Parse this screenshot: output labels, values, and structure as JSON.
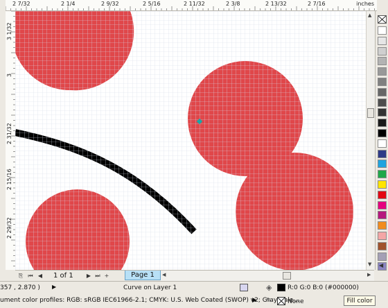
{
  "rulers": {
    "horizontal_labels": [
      "2  7/32",
      "2  1/4",
      "2  9/32",
      "2  5/16",
      "2  11/32",
      "2  3/8",
      "2  13/32",
      "2  7/16"
    ],
    "units": "inches",
    "vertical_labels": [
      "3  1/32",
      "3",
      "2  31/32",
      "2  15/16",
      "2  29/32"
    ]
  },
  "page_nav": {
    "first": "⏮",
    "prev": "◀",
    "next": "▶",
    "last": "⏭",
    "page_count": "1 of 1",
    "add_page": "+",
    "page_tab": "Page 1"
  },
  "status": {
    "coordinates": "357 , 2.870 )",
    "object_info": "Curve on Layer 1",
    "color_profiles": "ument color profiles: RGB: sRGB IEC61966-2.1; CMYK: U.S. Web Coated (SWOP) v2; Grayscale...",
    "fill_value": "R:0 G:0 B:0 (#000000)",
    "outline_value": "None",
    "tooltip": "Fill color"
  },
  "palette": {
    "colors": [
      "#ffffff",
      "#e6e6e6",
      "#cfcfcf",
      "#b3b3b3",
      "#999999",
      "#808080",
      "#666666",
      "#4d4d4d",
      "#333333",
      "#1a1a1a",
      "#000000",
      "#ffffff",
      "#2e3a87",
      "#1fa3df",
      "#1ea84a",
      "#ffe500",
      "#e30613",
      "#e5007e",
      "#b6187e",
      "#f28c1f",
      "#f4a6a6",
      "#a0522d",
      "#a49fb5",
      "#8b85c1"
    ]
  },
  "canvas": {
    "fill_color": "#e0474a",
    "curve_color": "#000000",
    "node_color": "#1aa6a6"
  }
}
